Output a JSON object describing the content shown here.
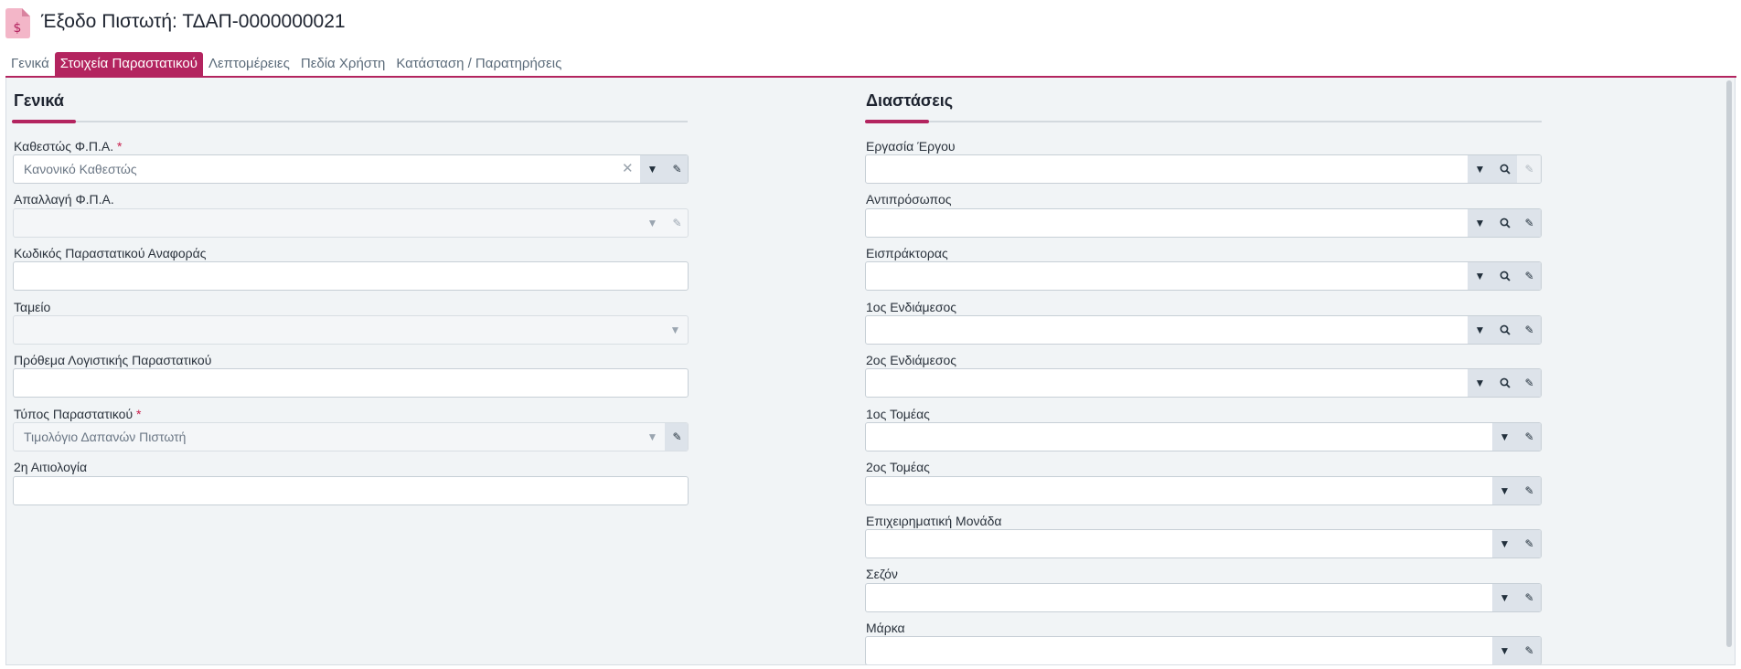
{
  "header": {
    "title": "Έξοδο Πιστωτή: ΤΔΑΠ-0000000021",
    "icon": "invoice-dollar-icon"
  },
  "tabs": [
    {
      "label": "Γενικά",
      "active": false
    },
    {
      "label": "Στοιχεία Παραστατικού",
      "active": true
    },
    {
      "label": "Λεπτομέρειες",
      "active": false
    },
    {
      "label": "Πεδία Χρήστη",
      "active": false
    },
    {
      "label": "Κατάσταση / Παρατηρήσεις",
      "active": false
    }
  ],
  "general": {
    "title": "Γενικά",
    "vat_status": {
      "label": "Καθεστώς Φ.Π.Α.",
      "required": "*",
      "value": "Κανονικό Καθεστώς"
    },
    "vat_exemption": {
      "label": "Απαλλαγή Φ.Π.Α.",
      "value": ""
    },
    "reference_code": {
      "label": "Κωδικός Παραστατικού Αναφοράς",
      "value": ""
    },
    "cash_register": {
      "label": "Ταμείο",
      "value": ""
    },
    "accounting_prefix": {
      "label": "Πρόθεμα Λογιστικής Παραστατικού",
      "value": ""
    },
    "document_type": {
      "label": "Τύπος Παραστατικού",
      "required": "*",
      "value": "Τιμολόγιο Δαπανών Πιστωτή"
    },
    "second_reason": {
      "label": "2η Αιτιολογία",
      "value": ""
    }
  },
  "dimensions": {
    "title": "Διαστάσεις",
    "project_task": {
      "label": "Εργασία Έργου",
      "value": ""
    },
    "representative": {
      "label": "Αντιπρόσωπος",
      "value": ""
    },
    "collector": {
      "label": "Εισπράκτορας",
      "value": ""
    },
    "intermediary_1": {
      "label": "1ος Ενδιάμεσος",
      "value": ""
    },
    "intermediary_2": {
      "label": "2ος Ενδιάμεσος",
      "value": ""
    },
    "sector_1": {
      "label": "1ος Τομέας",
      "value": ""
    },
    "sector_2": {
      "label": "2ος Τομέας",
      "value": ""
    },
    "business_unit": {
      "label": "Επιχειρηματική Μονάδα",
      "value": ""
    },
    "season": {
      "label": "Σεζόν",
      "value": ""
    },
    "brand": {
      "label": "Μάρκα",
      "value": ""
    }
  },
  "colors": {
    "accent": "#b3245f",
    "panel": "#f1f4f6"
  }
}
